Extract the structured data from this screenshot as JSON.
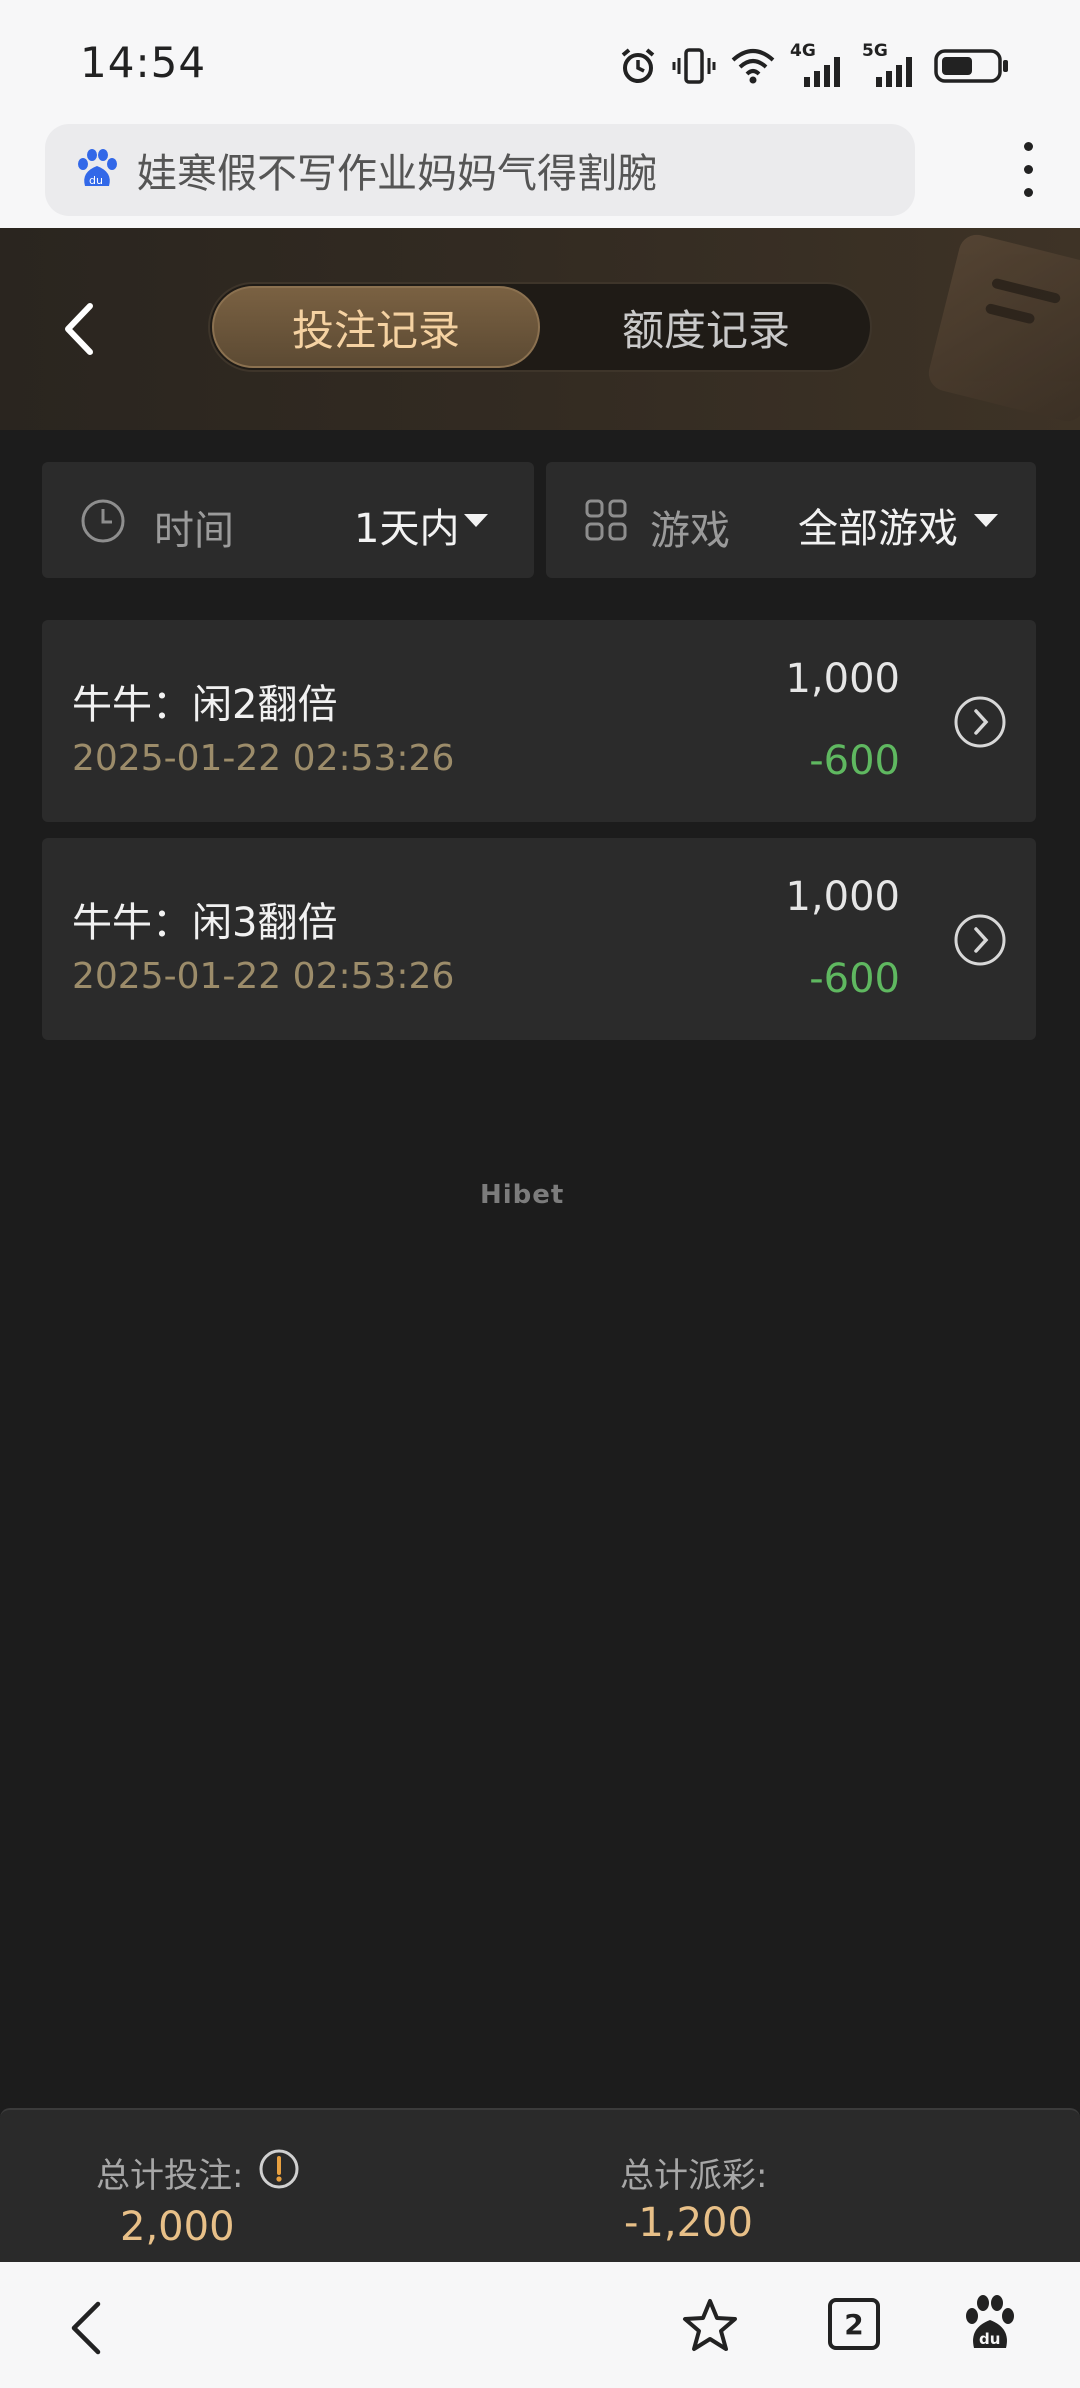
{
  "status_bar": {
    "time": "14:54",
    "icons": [
      "alarm-icon",
      "vibrate-icon",
      "wifi-icon",
      "signal-4g-icon",
      "signal-5g-icon",
      "battery-icon"
    ],
    "network_labels": [
      "4G",
      "5G"
    ]
  },
  "browser": {
    "search_text": "娃寒假不写作业妈妈气得割腕",
    "logo": "baidu-icon",
    "tab_count": "2"
  },
  "header": {
    "tabs": [
      {
        "label": "投注记录",
        "active": true
      },
      {
        "label": "额度记录",
        "active": false
      }
    ],
    "accent_color": "#f5d2a2"
  },
  "filters": {
    "time": {
      "label": "时间",
      "value": "1天内"
    },
    "game": {
      "label": "游戏",
      "value": "全部游戏"
    }
  },
  "records": [
    {
      "title": "牛牛：闲2翻倍",
      "time": "2025-01-22 02:53:26",
      "amount": "1,000",
      "payout": "-600"
    },
    {
      "title": "牛牛：闲3翻倍",
      "time": "2025-01-22 02:53:26",
      "amount": "1,000",
      "payout": "-600"
    }
  ],
  "watermark": "Hibet",
  "summary": {
    "total_bet_label": "总计投注:",
    "total_bet_value": "2,000",
    "total_payout_label": "总计派彩:",
    "total_payout_value": "-1,200"
  },
  "colors": {
    "background": "#1c1c1c",
    "card": "#2b2b2b",
    "payout_negative": "#5fb860",
    "summary_value": "#e8c088"
  }
}
